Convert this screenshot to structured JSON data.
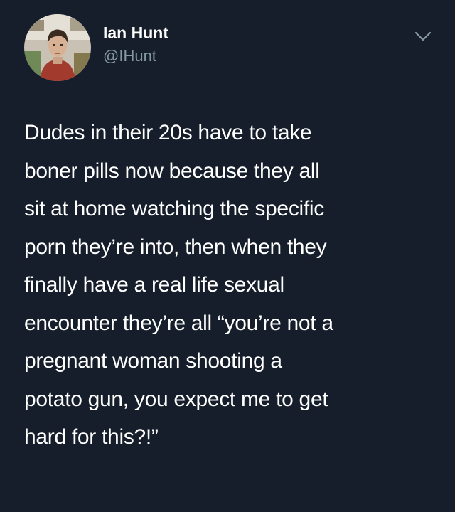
{
  "theme": {
    "background": "#151e2a",
    "text_color": "#ffffff",
    "secondary_text_color": "#8899a6"
  },
  "user": {
    "display_name": "Ian Hunt",
    "handle": "@IHunt",
    "avatar_icon": "profile-photo"
  },
  "menu": {
    "icon": "chevron-down-icon"
  },
  "tweet": {
    "lines": [
      "Dudes in their 20s have to take",
      "boner pills now because they all",
      "sit at home watching the specific",
      "porn they’re into, then when they",
      "finally have a real life sexual",
      "encounter they’re all “you’re not a",
      "pregnant woman shooting a",
      "potato gun, you expect me to get",
      "hard for this?!”"
    ]
  }
}
